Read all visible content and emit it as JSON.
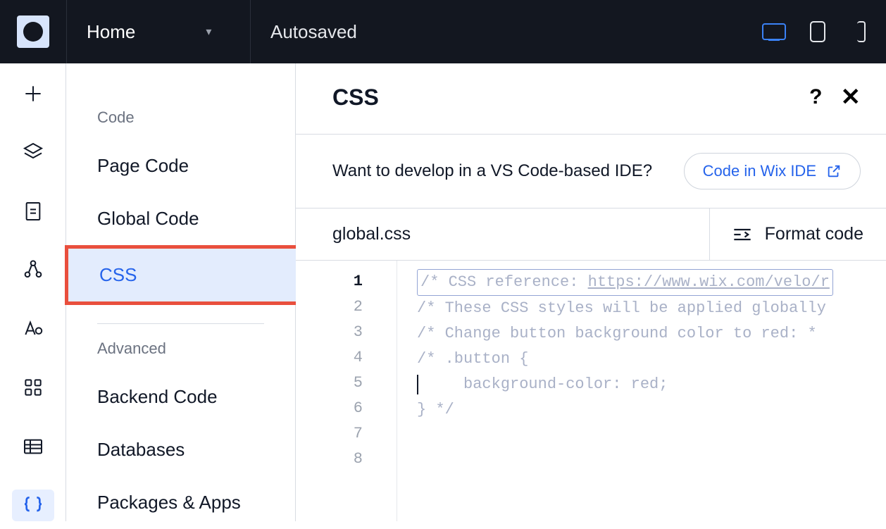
{
  "topbar": {
    "page_label": "Home",
    "status": "Autosaved"
  },
  "sidebar": {
    "section1_heading": "Code",
    "items1": [
      "Page Code",
      "Global Code",
      "CSS"
    ],
    "section2_heading": "Advanced",
    "items2": [
      "Backend Code",
      "Databases",
      "Packages & Apps"
    ]
  },
  "content": {
    "title": "CSS",
    "ide_prompt": "Want to develop in a VS Code-based IDE?",
    "ide_button": "Code in Wix IDE",
    "file_name": "global.css",
    "format_label": "Format code"
  },
  "editor": {
    "line_numbers": [
      "1",
      "2",
      "3",
      "4",
      "5",
      "6",
      "7",
      "8"
    ],
    "lines": [
      "/* CSS reference: https://www.wix.com/velo/r",
      "",
      "/* These CSS styles will be applied globally",
      "",
      "/*  Change button background color to red: *",
      "/* .button {",
      "     background-color: red;",
      "} */"
    ]
  }
}
